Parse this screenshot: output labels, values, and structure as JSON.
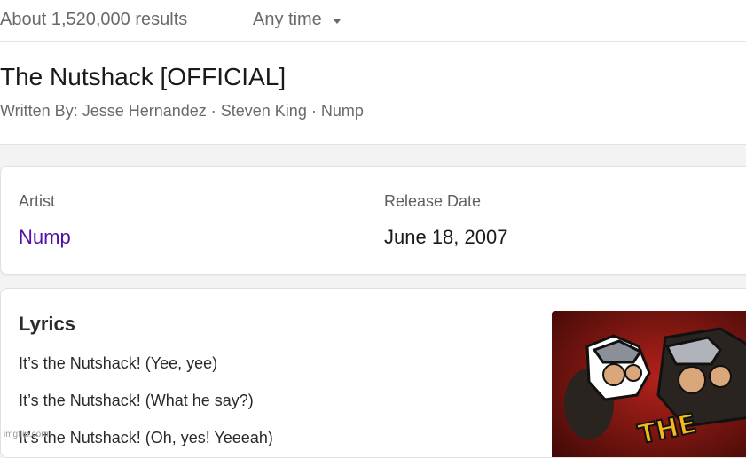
{
  "search": {
    "results_count": "About 1,520,000 results",
    "time_filter": "Any time"
  },
  "song": {
    "title": "The Nutshack [OFFICIAL]",
    "writers": "Written By: Jesse Hernandez · Steven King · Nump"
  },
  "details": {
    "artist_label": "Artist",
    "artist_value": "Nump",
    "release_label": "Release Date",
    "release_value": "June 18, 2007"
  },
  "lyrics": {
    "heading": "Lyrics",
    "lines": [
      "It’s the Nutshack! (Yee, yee)",
      "It’s the Nutshack! (What he say?)",
      "It’s the Nutshack! (Oh, yes! Yeeeah)"
    ]
  },
  "album_art": {
    "text": "THE"
  },
  "watermark": "imgflip.com",
  "colors": {
    "link_purple": "#4b11a8",
    "art_red": "#7a1410"
  }
}
